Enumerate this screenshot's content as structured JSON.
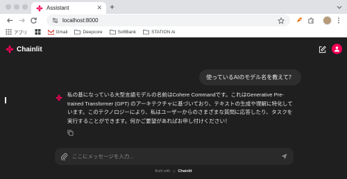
{
  "browser": {
    "tab_title": "Assistant",
    "url": "localhost:8000",
    "bookmarks": [
      {
        "label": "アプリ",
        "icon": "apps-grid-icon"
      },
      {
        "label": "Gmail",
        "icon": "gmail-icon"
      },
      {
        "label": "Deepcore",
        "icon": "folder-icon"
      },
      {
        "label": "SoftBank",
        "icon": "folder-icon"
      },
      {
        "label": "STATION Ai",
        "icon": "folder-icon"
      }
    ]
  },
  "app": {
    "brand": "Chainlit",
    "accent": "#f50057",
    "user_message": "使っているAIのモデル名を教えて？",
    "assistant_message": "私の基になっている大型言語モデルの名前はCohere Commandです。これはGenerative Pre-trained Transformer (GPT) のアーキテクチャに基づいており、テキストの生成や理解に特化しています。このテクノロジーにより、私はユーザーからのさまざまな質問に応答したり、タスクを実行することができます。何かご要望があればお申し付けください！",
    "composer": {
      "placeholder": "ここにメッセージを入力..."
    },
    "footer": {
      "built_with": "Built with",
      "brand": "Chainlit"
    }
  }
}
